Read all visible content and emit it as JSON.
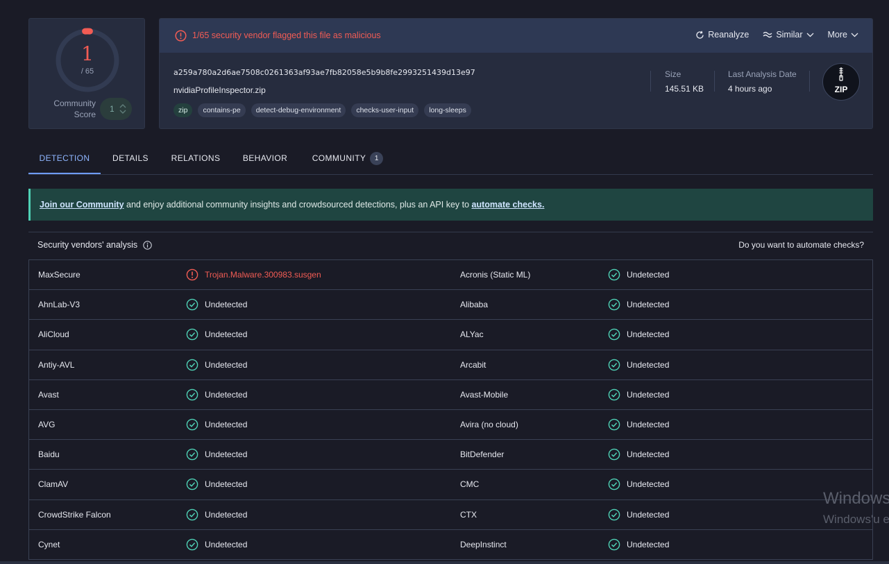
{
  "score": {
    "detections": "1",
    "total": "/ 65",
    "community_label": "Community Score",
    "community_value": "1"
  },
  "alert": {
    "text": "1/65 security vendor flagged this file as malicious"
  },
  "actions": {
    "reanalyze": "Reanalyze",
    "similar": "Similar",
    "more": "More"
  },
  "file": {
    "hash": "a259a780a2d6ae7508c0261363af93ae7fb82058e5b9b8fe2993251439d13e97",
    "name": "nvidiaProfileInspector.zip",
    "tags": [
      "zip",
      "contains-pe",
      "detect-debug-environment",
      "checks-user-input",
      "long-sleeps"
    ],
    "size_label": "Size",
    "size_value": "145.51 KB",
    "date_label": "Last Analysis Date",
    "date_value": "4 hours ago",
    "type_badge": "ZIP"
  },
  "tabs": [
    {
      "label": "DETECTION"
    },
    {
      "label": "DETAILS"
    },
    {
      "label": "RELATIONS"
    },
    {
      "label": "BEHAVIOR"
    },
    {
      "label": "COMMUNITY",
      "badge": "1"
    }
  ],
  "banner": {
    "link1": "Join our Community",
    "middle": " and enjoy additional community insights and crowdsourced detections, plus an API key to ",
    "link2": "automate checks."
  },
  "vendors_section": {
    "title": "Security vendors' analysis",
    "right_link": "Do you want to automate checks?"
  },
  "vendors": [
    {
      "left_name": "MaxSecure",
      "left_result": "Trojan.Malware.300983.susgen",
      "left_status": "malicious",
      "right_name": "Acronis (Static ML)",
      "right_result": "Undetected",
      "right_status": "undetected"
    },
    {
      "left_name": "AhnLab-V3",
      "left_result": "Undetected",
      "left_status": "undetected",
      "right_name": "Alibaba",
      "right_result": "Undetected",
      "right_status": "undetected"
    },
    {
      "left_name": "AliCloud",
      "left_result": "Undetected",
      "left_status": "undetected",
      "right_name": "ALYac",
      "right_result": "Undetected",
      "right_status": "undetected"
    },
    {
      "left_name": "Antiy-AVL",
      "left_result": "Undetected",
      "left_status": "undetected",
      "right_name": "Arcabit",
      "right_result": "Undetected",
      "right_status": "undetected"
    },
    {
      "left_name": "Avast",
      "left_result": "Undetected",
      "left_status": "undetected",
      "right_name": "Avast-Mobile",
      "right_result": "Undetected",
      "right_status": "undetected"
    },
    {
      "left_name": "AVG",
      "left_result": "Undetected",
      "left_status": "undetected",
      "right_name": "Avira (no cloud)",
      "right_result": "Undetected",
      "right_status": "undetected"
    },
    {
      "left_name": "Baidu",
      "left_result": "Undetected",
      "left_status": "undetected",
      "right_name": "BitDefender",
      "right_result": "Undetected",
      "right_status": "undetected"
    },
    {
      "left_name": "ClamAV",
      "left_result": "Undetected",
      "left_status": "undetected",
      "right_name": "CMC",
      "right_result": "Undetected",
      "right_status": "undetected"
    },
    {
      "left_name": "CrowdStrike Falcon",
      "left_result": "Undetected",
      "left_status": "undetected",
      "right_name": "CTX",
      "right_result": "Undetected",
      "right_status": "undetected"
    },
    {
      "left_name": "Cynet",
      "left_result": "Undetected",
      "left_status": "undetected",
      "right_name": "DeepInstinct",
      "right_result": "Undetected",
      "right_status": "undetected"
    }
  ],
  "watermark": {
    "line1": "Windows",
    "line2": "Windows'u e"
  },
  "colors": {
    "malicious": "#f25c54",
    "undetected": "#4fd1b5",
    "accent": "#6e9bff"
  }
}
